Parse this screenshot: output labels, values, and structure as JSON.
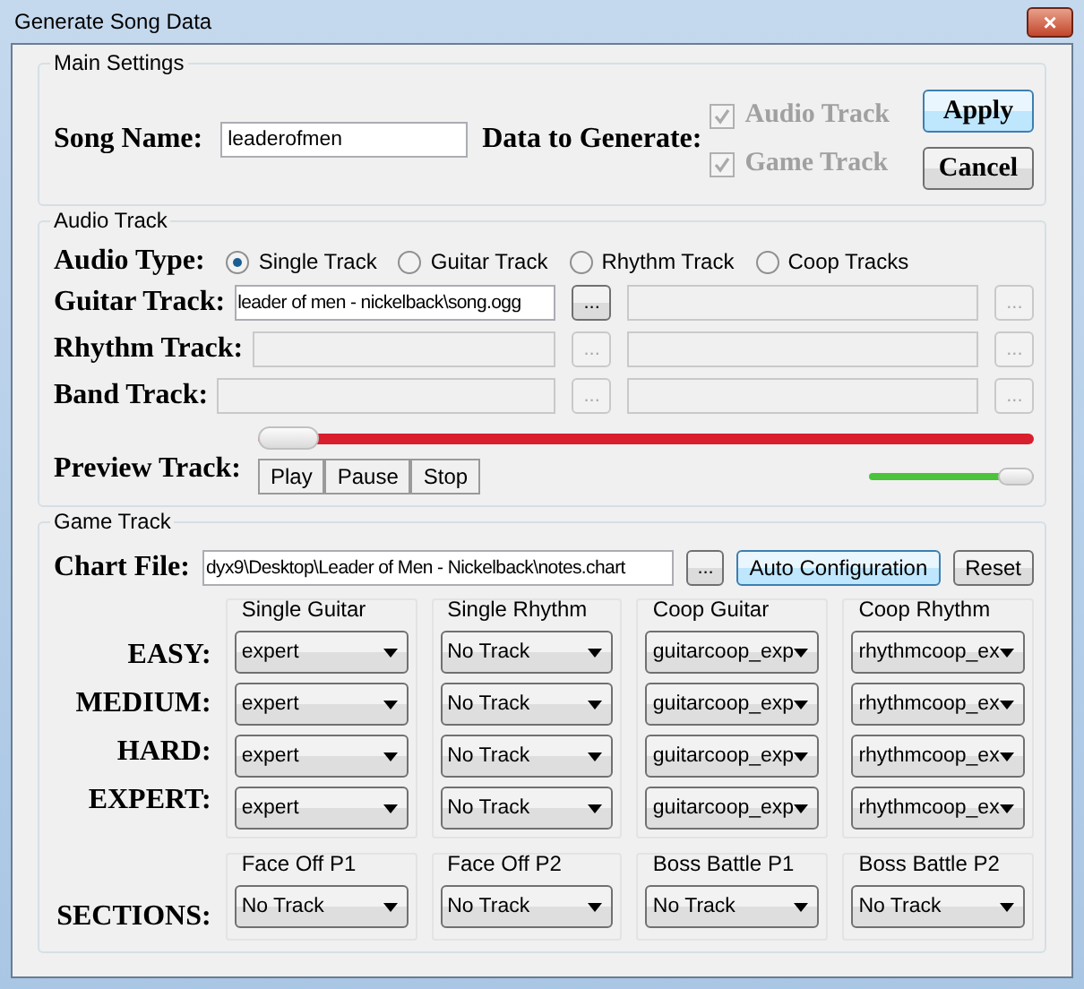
{
  "window": {
    "title": "Generate Song Data",
    "close": "×"
  },
  "main_settings": {
    "title": "Main Settings",
    "song_name_label": "Song Name:",
    "song_name_value": "leaderofmen",
    "data_label": "Data to Generate:",
    "checks": [
      {
        "label": "Audio Track",
        "checked": true,
        "disabled": true
      },
      {
        "label": "Game Track",
        "checked": true,
        "disabled": true
      }
    ],
    "buttons": [
      {
        "label": "Apply",
        "default": true
      },
      {
        "label": "Cancel",
        "default": false
      }
    ]
  },
  "audio_track": {
    "title": "Audio Track",
    "audio_type_label": "Audio Type:",
    "audio_types": [
      {
        "label": "Single Track",
        "selected": true
      },
      {
        "label": "Guitar Track",
        "selected": false
      },
      {
        "label": "Rhythm Track",
        "selected": false
      },
      {
        "label": "Coop Tracks",
        "selected": false
      }
    ],
    "rows": [
      {
        "label": "Guitar Track:",
        "fields": [
          {
            "value": "leader of men - nickelback\\song.ogg",
            "disabled": false
          },
          {
            "disabled": true
          }
        ],
        "browse": [
          {
            "label": "...",
            "disabled": false
          },
          {
            "label": "...",
            "disabled": true
          }
        ]
      },
      {
        "label": "Rhythm Track:",
        "fields": [
          {
            "disabled": true
          },
          {
            "disabled": true
          }
        ],
        "browse": [
          {
            "label": "...",
            "disabled": true
          },
          {
            "label": "...",
            "disabled": true
          }
        ]
      },
      {
        "label": "Band Track:",
        "fields": [
          {
            "disabled": true
          },
          {
            "disabled": true
          }
        ],
        "browse": [
          {
            "label": "...",
            "disabled": true
          },
          {
            "label": "...",
            "disabled": true
          }
        ]
      }
    ],
    "preview_label": "Preview Track:",
    "position": {
      "level": 0
    },
    "volume": {
      "level": 1
    },
    "controls": [
      "Play",
      "Pause",
      "Stop"
    ]
  },
  "game_track": {
    "title": "Game Track",
    "chart_label": "Chart File:",
    "chart_value": "dyx9\\Desktop\\Leader of Men - Nickelback\\notes.chart",
    "browse": "...",
    "auto_button": "Auto Configuration",
    "reset_button": "Reset",
    "columns": [
      "Single Guitar",
      "Single Rhythm",
      "Coop Guitar",
      "Coop Rhythm"
    ],
    "rows": [
      {
        "label": "EASY:",
        "values": [
          "expert",
          "No Track",
          "guitarcoop_exp",
          "rhythmcoop_ex"
        ]
      },
      {
        "label": "MEDIUM:",
        "values": [
          "expert",
          "No Track",
          "guitarcoop_exp",
          "rhythmcoop_ex"
        ]
      },
      {
        "label": "HARD:",
        "values": [
          "expert",
          "No Track",
          "guitarcoop_exp",
          "rhythmcoop_ex"
        ]
      },
      {
        "label": "EXPERT:",
        "values": [
          "expert",
          "No Track",
          "guitarcoop_exp",
          "rhythmcoop_ex"
        ]
      }
    ],
    "sections_label": "SECTIONS:",
    "sections": [
      {
        "title": "Face Off P1",
        "value": "No Track"
      },
      {
        "title": "Face Off P2",
        "value": "No Track"
      },
      {
        "title": "Boss Battle P1",
        "value": "No Track"
      },
      {
        "title": "Boss Battle P2",
        "value": "No Track"
      }
    ]
  }
}
